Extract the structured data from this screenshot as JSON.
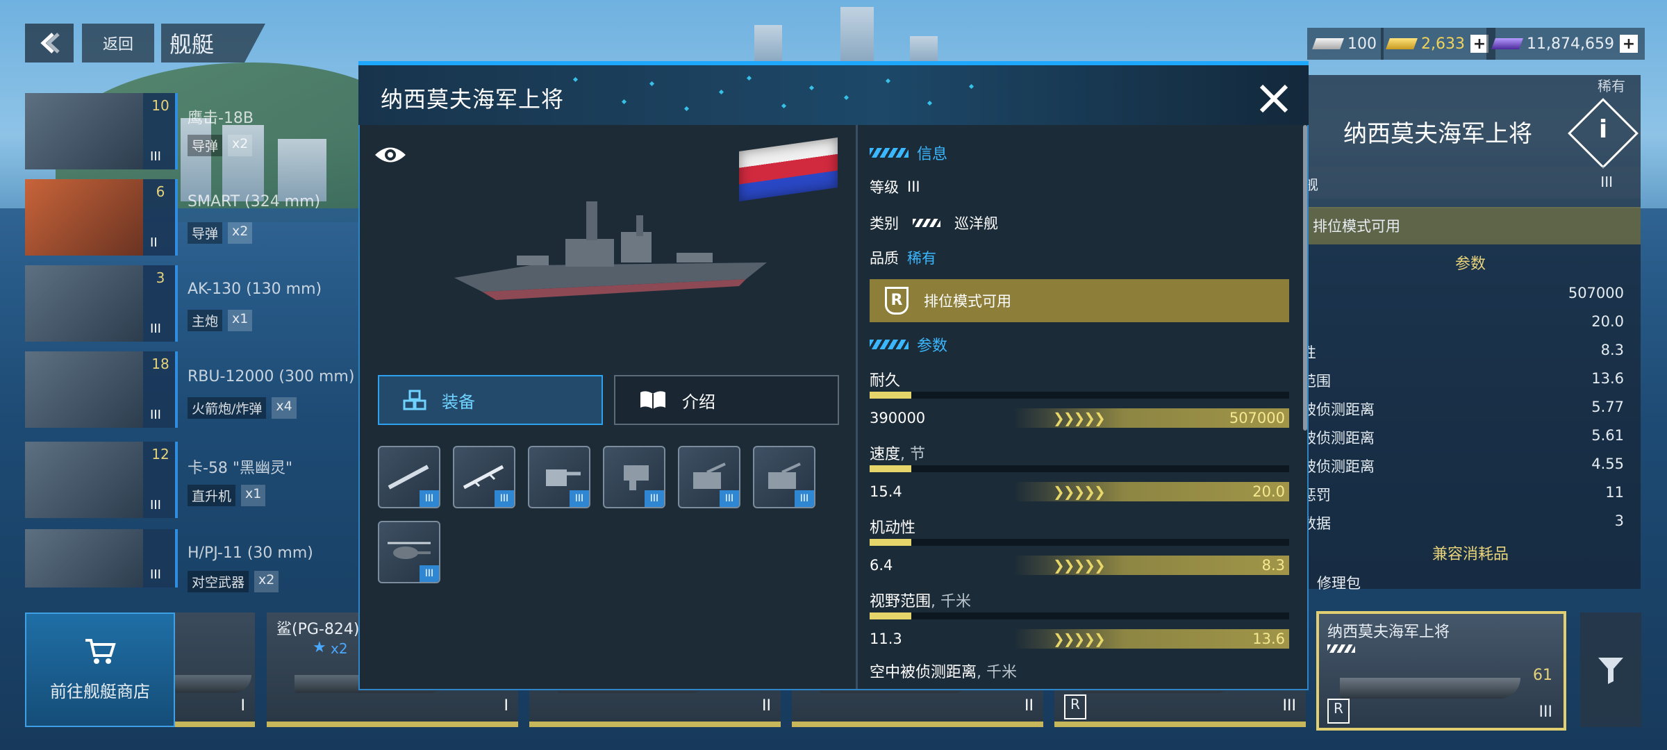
{
  "nav": {
    "back_label": "返回",
    "page_title": "舰艇"
  },
  "currency": {
    "silver": "100",
    "gold": "2,633",
    "premium": "11,874,659"
  },
  "weapons": [
    {
      "name": "鹰击-18B",
      "type": "导弹",
      "count": "x2",
      "level": "10",
      "tier": "III"
    },
    {
      "name": "SMART (324 mm)",
      "type": "导弹",
      "count": "x2",
      "level": "6",
      "tier": "II"
    },
    {
      "name": "AK-130 (130 mm)",
      "type": "主炮",
      "count": "x1",
      "level": "3",
      "tier": "III"
    },
    {
      "name": "RBU-12000 (300 mm)",
      "type": "火箭炮/炸弹",
      "count": "x4",
      "level": "18",
      "tier": "III"
    },
    {
      "name": "卡-58 \"黑幽灵\"",
      "type": "直升机",
      "count": "x1",
      "level": "12",
      "tier": "III"
    },
    {
      "name": "H/PJ-11 (30 mm)",
      "type": "对空武器",
      "count": "x2",
      "level": "",
      "tier": "III"
    }
  ],
  "side_panel": {
    "rarity": "稀有",
    "title": "纳西莫夫海军上将",
    "class_row": "舰",
    "class_tier": "III",
    "ranked": "排位模式可用",
    "params_title": "参数",
    "params": [
      {
        "label": "",
        "value": "507000"
      },
      {
        "label": "",
        "value": "20.0"
      },
      {
        "label": "性",
        "value": "8.3"
      },
      {
        "label": "范围",
        "value": "13.6"
      },
      {
        "label": "被侦测距离",
        "value": "5.77"
      },
      {
        "label": "被侦测距离",
        "value": "5.61"
      },
      {
        "label": "被侦测距离",
        "value": "4.55"
      },
      {
        "label": "惩罚",
        "value": "11"
      },
      {
        "label": "数据",
        "value": "3"
      }
    ],
    "consumables_title": "兼容消耗品",
    "consumable_1": "修理包"
  },
  "carousel": {
    "shop_label": "前往舰艇商店",
    "cards": [
      {
        "title": "",
        "tier": "I"
      },
      {
        "title": "鲨(PG-824)",
        "stars": "x2",
        "tier": "I"
      },
      {
        "title": "",
        "tier": "II"
      },
      {
        "title": "",
        "tier": "II"
      },
      {
        "title": "",
        "tier": "III"
      }
    ],
    "selected": {
      "title": "纳西莫夫海军上将",
      "level": "61",
      "tier": "III"
    }
  },
  "modal": {
    "title": "纳西莫夫海军上将",
    "tabs": {
      "equipment": "装备",
      "intro": "介绍"
    },
    "equipment_slots": [
      {
        "icon": "missile-icon",
        "tier": "III"
      },
      {
        "icon": "missile-icon",
        "tier": "III"
      },
      {
        "icon": "cannon-icon",
        "tier": "III"
      },
      {
        "icon": "rocket-launcher-icon",
        "tier": "III"
      },
      {
        "icon": "aa-gun-icon",
        "tier": "III"
      },
      {
        "icon": "aa-gun-icon",
        "tier": "III"
      },
      {
        "icon": "helicopter-icon",
        "tier": "III"
      }
    ],
    "info": {
      "section": "信息",
      "grade_label": "等级",
      "grade_value": "III",
      "class_label": "类别",
      "class_value": "巡洋舰",
      "quality_label": "品质",
      "quality_value": "稀有",
      "ranked": "排位模式可用"
    },
    "params": {
      "section": "参数",
      "stats": [
        {
          "label": "耐久",
          "unit": "",
          "base": "390000",
          "max": "507000",
          "fill": 0.1
        },
        {
          "label": "速度",
          "unit": ", 节",
          "base": "15.4",
          "max": "20.0",
          "fill": 0.1
        },
        {
          "label": "机动性",
          "unit": "",
          "base": "6.4",
          "max": "8.3",
          "fill": 0.1
        },
        {
          "label": "视野范围",
          "unit": ", 千米",
          "base": "11.3",
          "max": "13.6",
          "fill": 0.1
        }
      ],
      "partial_label": "空中被侦测距离",
      "partial_unit": ", 千米"
    }
  },
  "colors": {
    "accent": "#1ea7ff",
    "gold": "#e6d56a",
    "ranked": "#8d7e39"
  }
}
